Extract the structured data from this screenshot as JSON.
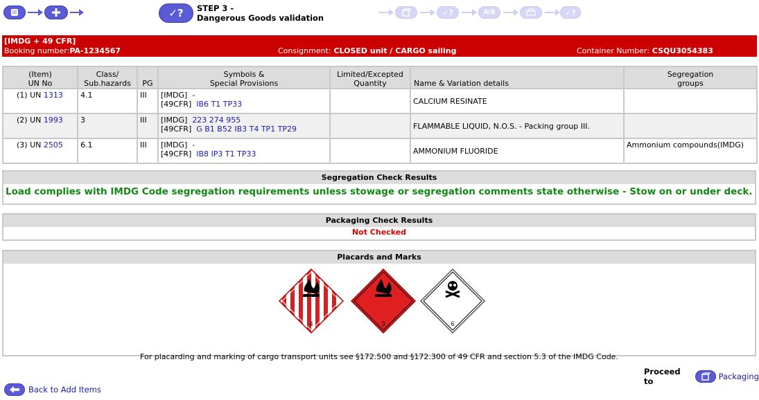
{
  "steps": {
    "step_title_line1": "STEP 3 -",
    "step_title_line2": "Dangerous Goods validation"
  },
  "header": {
    "regimes": "[IMDG + 49 CFR]",
    "booking_label": "Booking number:",
    "booking_value": "PA-1234567",
    "consignment_label": "Consignment:",
    "consignment_value": "CLOSED unit / CARGO sailing",
    "container_label": "Container Number:",
    "container_value": "CSQU3054383",
    "bar_color": "#cc0000"
  },
  "table": {
    "headers": {
      "item_un_1": "(Item)",
      "item_un_2": "UN No",
      "class_1": "Class/",
      "class_2": "Sub.hazards",
      "pg": "PG",
      "symbols_1": "Symbols &",
      "symbols_2": "Special Provisions",
      "limited_1": "Limited/Excepted",
      "limited_2": "Quantity",
      "name": "Name & Variation details",
      "seg_1": "Segregation",
      "seg_2": "groups"
    },
    "rows": [
      {
        "item": "(1) UN",
        "un": "1313",
        "class": "4.1",
        "pg": "III",
        "imdg_label": "[IMDG]",
        "imdg_sp": "-",
        "cfr_label": "[49CFR]",
        "cfr_sp": "IB6 T1 TP33",
        "limited": "",
        "name": "CALCIUM RESINATE",
        "seg": ""
      },
      {
        "item": "(2) UN",
        "un": "1993",
        "class": "3",
        "pg": "III",
        "imdg_label": "[IMDG]",
        "imdg_sp": "223 274 955",
        "cfr_label": "[49CFR]",
        "cfr_sp": "G B1 B52 IB3 T4 TP1 TP29",
        "limited": "",
        "name": "FLAMMABLE LIQUID, N.O.S. - Packing group III.",
        "seg": ""
      },
      {
        "item": "(3) UN",
        "un": "2505",
        "class": "6.1",
        "pg": "III",
        "imdg_label": "[IMDG]",
        "imdg_sp": "-",
        "cfr_label": "[49CFR]",
        "cfr_sp": "IB8 IP3 T1 TP33",
        "limited": "",
        "name": "AMMONIUM FLUORIDE",
        "seg": "Ammonium compounds(IMDG)"
      }
    ]
  },
  "segregation": {
    "title": "Segregation Check Results",
    "message": "Load complies with IMDG Code segregation requirements unless stowage or segregation comments state otherwise - Stow on or under deck.",
    "message_color": "#118811"
  },
  "packaging": {
    "title": "Packaging Check Results",
    "status": "Not Checked",
    "status_color": "#dd0000"
  },
  "placards": {
    "title": "Placards and Marks",
    "items": [
      {
        "icon": "flammable-solid-placard-icon",
        "class_number": "4"
      },
      {
        "icon": "flammable-liquid-placard-icon",
        "class_number": "3"
      },
      {
        "icon": "toxic-placard-icon",
        "class_number": "6"
      }
    ],
    "note": "For placarding and marking of cargo transport units see §172.500 and §172.300 of 49 CFR and section 5.3 of the IMDG Code."
  },
  "footer": {
    "proceed_label": "Proceed to",
    "proceed_link": "Packaging",
    "back_link": "Back to Add Items"
  }
}
